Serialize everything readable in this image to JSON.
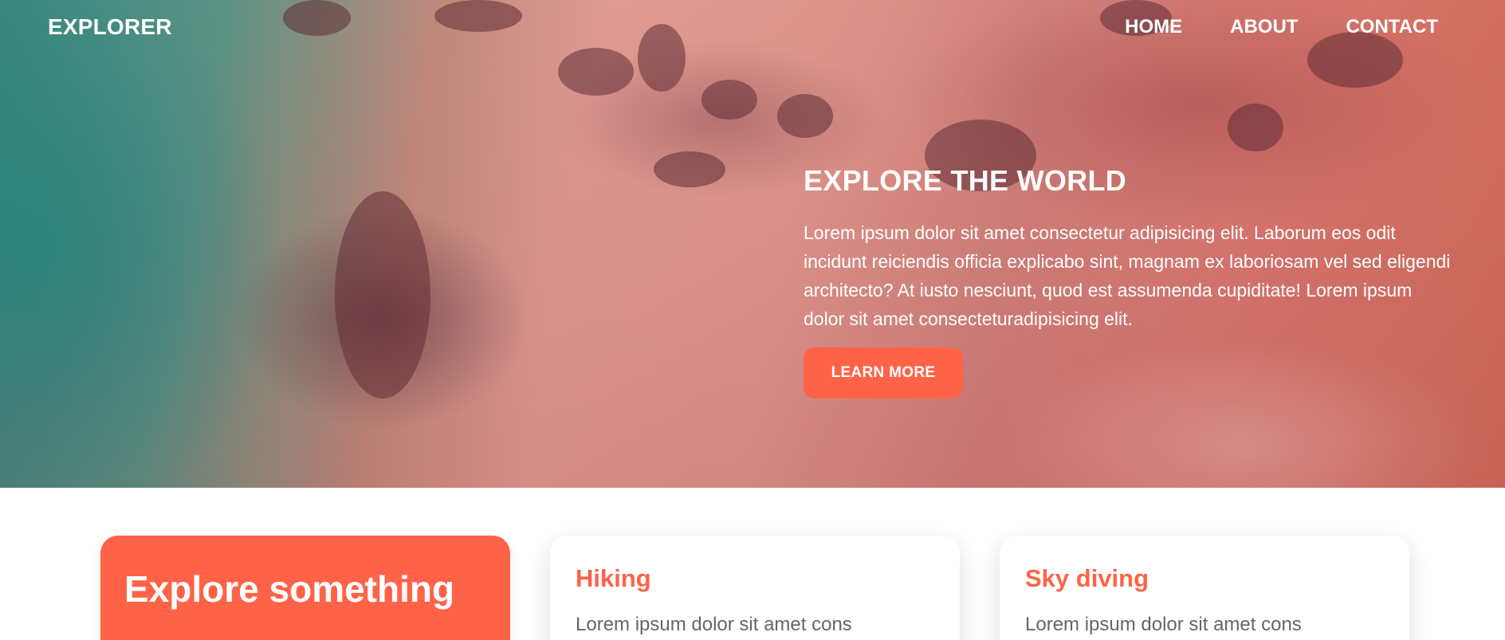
{
  "header": {
    "brand": "EXPLORER",
    "nav": [
      {
        "label": "HOME"
      },
      {
        "label": "ABOUT"
      },
      {
        "label": "CONTACT"
      }
    ]
  },
  "hero": {
    "title": "EXPLORE THE WORLD",
    "paragraph": "Lorem ipsum dolor sit amet consectetur adipisicing elit. Laborum eos odit incidunt reiciendis officia explicabo sint, magnam ex laboriosam vel sed eligendi architecto? At iusto nesciunt, quod est assumenda cupiditate! Lorem ipsum dolor sit amet consecteturadipisicing elit.",
    "button_label": "LEARN MORE"
  },
  "cards": [
    {
      "title": "Explore something"
    },
    {
      "title": "Hiking",
      "text": "Lorem ipsum dolor sit amet cons"
    },
    {
      "title": "Sky diving",
      "text": "Lorem ipsum dolor sit amet cons"
    }
  ],
  "colors": {
    "accent": "#ff6347",
    "text_light": "#ffffff",
    "body_text": "#666666"
  }
}
